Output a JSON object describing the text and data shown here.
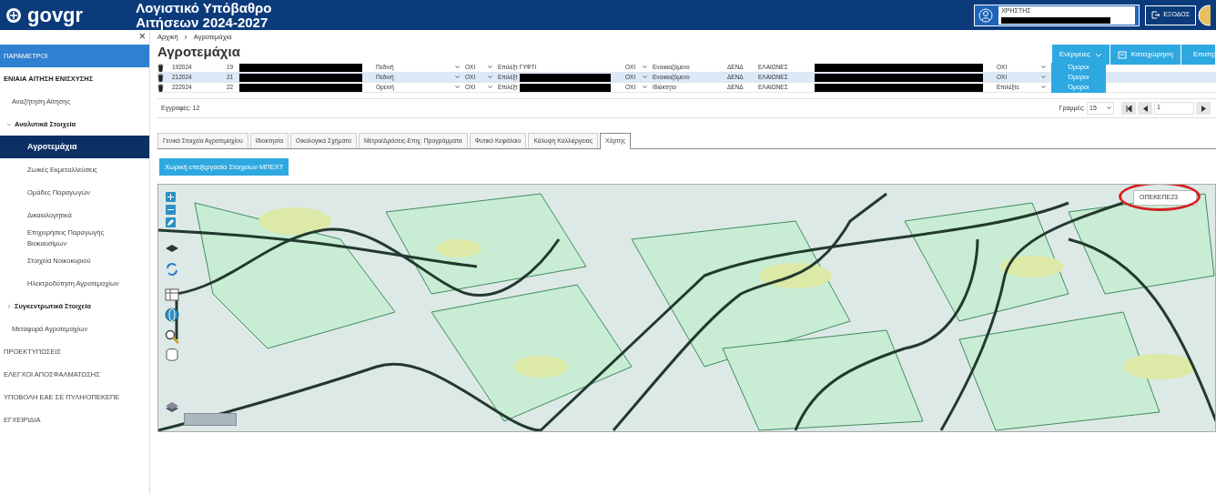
{
  "header": {
    "logo": "govgr",
    "title_lines": [
      "Λογιστικό Υπόβαθρο",
      "Αιτήσεων 2024-2027"
    ],
    "user_label": "ΧΡΗΣΤΗΣ",
    "logout": "ΕΞΟΔΟΣ"
  },
  "sidebar": {
    "close": "×",
    "items": [
      {
        "label": "ΠΑΡΑΜΕΤΡΟΙ",
        "kind": "banner",
        "selected": false
      },
      {
        "label": "ΕΝΙΑΙΑ ΑΙΤΗΣΗ ΕΝΙΣΧΥΣΗΣ",
        "kind": "section",
        "selected": false,
        "children": [
          {
            "label": "Αναζήτηση Αίτησης",
            "kind": "item",
            "selected": false
          },
          {
            "label": "Αναλυτικά Στοιχεία",
            "kind": "group",
            "expanded": true,
            "selected": false,
            "children": [
              {
                "label": "Αγροτεμάχια",
                "kind": "item",
                "selected": true
              },
              {
                "label": "Ζωικές Εκμεταλλεύσεις",
                "kind": "item",
                "selected": false
              },
              {
                "label": "Ομάδες Παραγωγών",
                "kind": "item",
                "selected": false
              },
              {
                "label": "Δικαιολογητικά",
                "kind": "item",
                "selected": false
              },
              {
                "label": "Επιχειρήσεις Παραγωγής Βιοκαυσίμων",
                "kind": "item",
                "selected": false
              },
              {
                "label": "Στοιχεία Νοικοκυριού",
                "kind": "item",
                "selected": false
              },
              {
                "label": "Ηλεκτροδότηση Αγροτεμαχίων",
                "kind": "item",
                "selected": false
              }
            ]
          },
          {
            "label": "Συγκεντρωτικά Στοιχεία",
            "kind": "group",
            "expanded": false,
            "selected": false
          },
          {
            "label": "Μεταφορά Αγροτεμαχίων",
            "kind": "item",
            "selected": false
          }
        ]
      },
      {
        "label": "ΠΡΟΕΚΤΥΠΩΣΕΙΣ",
        "kind": "section",
        "selected": false
      },
      {
        "label": "ΕΛΕΓΧΟΙ ΑΠΟΣΦΑΛΜΑΤΩΣΗΣ",
        "kind": "section",
        "selected": false
      },
      {
        "label": "ΥΠΟΒΟΛΗ ΕΑΕ ΣΕ ΠΥΛΗ/ΟΠΕΚΕΠΕ",
        "kind": "section",
        "selected": false
      },
      {
        "label": "ΕΓΧΕΙΡΙΔΙΑ",
        "kind": "section",
        "selected": false
      }
    ]
  },
  "breadcrumb": [
    "Αρχική",
    "Αγροτεμάχια"
  ],
  "page_title": "Αγροτεμάχια",
  "actions": [
    "Ενέργειες",
    "Καταχώρηση",
    "Επιστρ"
  ],
  "table": {
    "rows": [
      {
        "selected": false,
        "cells": [
          {
            "kind": "delete"
          },
          {
            "kind": "text",
            "text": "192024"
          },
          {
            "kind": "text",
            "text": "19"
          },
          {
            "kind": "redacted"
          },
          {
            "kind": "select",
            "text": "Πεδινή"
          },
          {
            "kind": "select",
            "text": "ΟΧΙ"
          },
          {
            "kind": "field",
            "text": "Επιλέξτ",
            "value": "ΓΥΦΤΙ"
          },
          {
            "kind": "select",
            "text": "ΟΧΙ"
          },
          {
            "kind": "text",
            "text": "Ενοικιαζόμενο"
          },
          {
            "kind": "text",
            "text": "ΔΕΝΔ"
          },
          {
            "kind": "text",
            "text": "ΕΛΑΙΩΝΕΣ"
          },
          {
            "kind": "redacted"
          },
          {
            "kind": "select",
            "text": "ΟΧΙ"
          },
          {
            "kind": "button",
            "text": "Όμοροι"
          }
        ]
      },
      {
        "selected": true,
        "cells": [
          {
            "kind": "delete"
          },
          {
            "kind": "text",
            "text": "212024"
          },
          {
            "kind": "text",
            "text": "21"
          },
          {
            "kind": "redacted"
          },
          {
            "kind": "select",
            "text": "Πεδινή"
          },
          {
            "kind": "select",
            "text": "ΟΧΙ"
          },
          {
            "kind": "field",
            "text": "Επιλέξτ"
          },
          {
            "kind": "select",
            "text": "ΟΧΙ"
          },
          {
            "kind": "text",
            "text": "Ενοικιαζόμενο"
          },
          {
            "kind": "text",
            "text": "ΔΕΝΔ"
          },
          {
            "kind": "text",
            "text": "ΕΛΑΙΩΝΕΣ"
          },
          {
            "kind": "redacted"
          },
          {
            "kind": "select",
            "text": "ΟΧΙ"
          },
          {
            "kind": "button",
            "text": "Όμοροι"
          }
        ]
      },
      {
        "selected": false,
        "cells": [
          {
            "kind": "delete"
          },
          {
            "kind": "text",
            "text": "222024"
          },
          {
            "kind": "text",
            "text": "22"
          },
          {
            "kind": "redacted"
          },
          {
            "kind": "select",
            "text": "Ορεινή"
          },
          {
            "kind": "select",
            "text": "ΟΧΙ"
          },
          {
            "kind": "field",
            "text": "Επιλέξτ"
          },
          {
            "kind": "select",
            "text": "ΟΧΙ"
          },
          {
            "kind": "text",
            "text": "Ιδιόκτητο"
          },
          {
            "kind": "text",
            "text": "ΔΕΝΔ"
          },
          {
            "kind": "text",
            "text": "ΕΛΑΙΩΝΕΣ"
          },
          {
            "kind": "redacted"
          },
          {
            "kind": "select",
            "text": "Επιλέξτε"
          },
          {
            "kind": "button",
            "text": "Όμοροι"
          }
        ]
      }
    ],
    "records": "Εγγραφές: 12",
    "rows_label": "Γραμμές:",
    "rows_per_page": "15",
    "page": "1"
  },
  "tabs": [
    {
      "label": "Γενικά Στοιχεία Αγροτεμαχίου",
      "selected": false
    },
    {
      "label": "Ιδιοκτησία",
      "selected": false
    },
    {
      "label": "Οικολογικά Σχήματα",
      "selected": false
    },
    {
      "label": "Μέτρα/Δράσεις-Επιχ. Προγράμματα",
      "selected": false
    },
    {
      "label": "Φυτικό Κεφάλαιο",
      "selected": false
    },
    {
      "label": "Κάλυψη Καλλιέργειας",
      "selected": false
    },
    {
      "label": "Χάρτης",
      "selected": true
    }
  ],
  "spatial_button": "Χωρική επεξεργασία Στοιχείων ΜΠΕΧΤ",
  "map": {
    "layer_label": "ΟΠΕΚΕΠΕ23"
  }
}
